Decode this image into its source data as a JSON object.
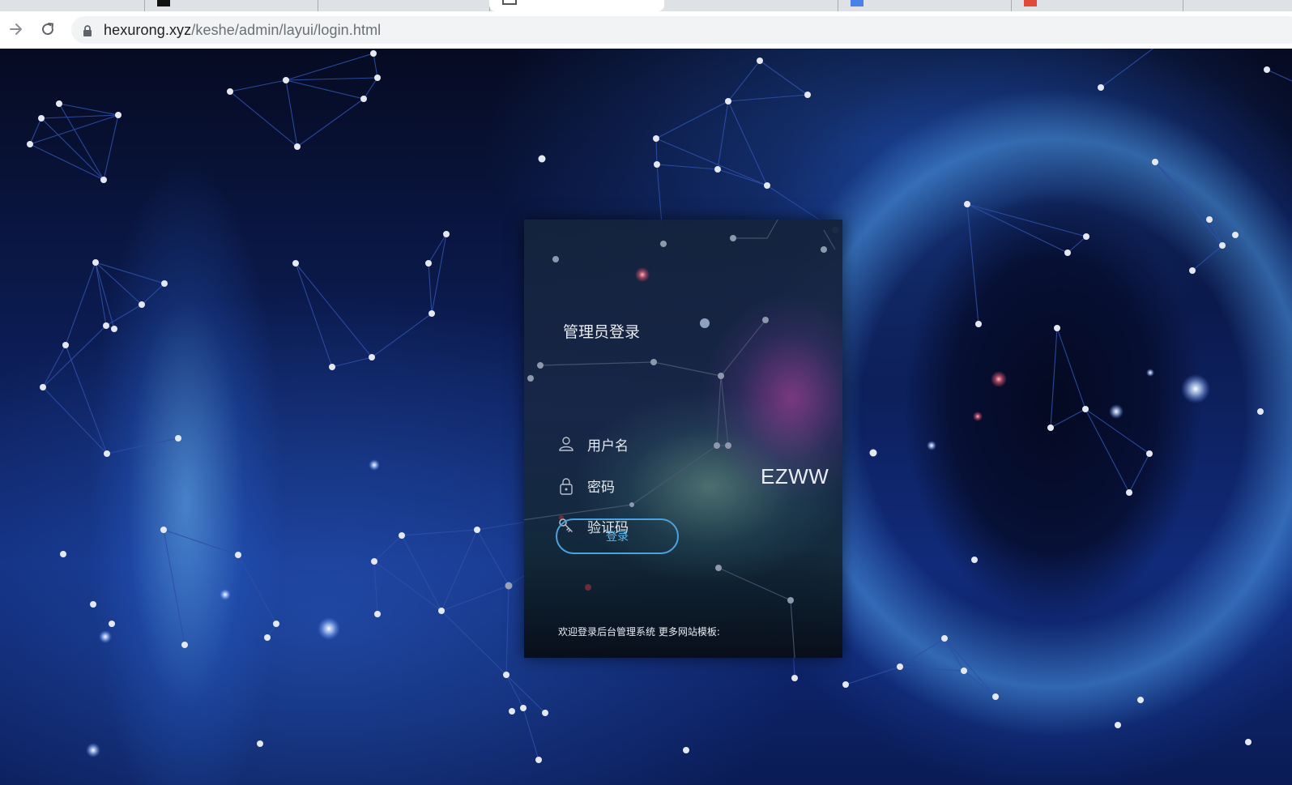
{
  "browser": {
    "url_host": "hexurong.xyz",
    "url_path": "/keshe/admin/layui/login.html",
    "icons": {
      "back": "arrow-right-icon",
      "reload": "reload-icon",
      "security": "lock-icon"
    }
  },
  "login": {
    "title": "管理员登录",
    "username_placeholder": "用户名",
    "password_placeholder": "密码",
    "captcha_placeholder": "验证码",
    "captcha_code": "EZWW",
    "submit_label": "登录",
    "footer_note": "欢迎登录后台管理系统 更多网站模板:",
    "icons": {
      "username": "user-icon",
      "password": "lock-icon",
      "captcha": "key-icon"
    }
  },
  "colors": {
    "button_border": "#4aa3df",
    "button_text": "#55b6ee",
    "network_line": "#2d4fa6",
    "network_node": "#e6e8f0"
  }
}
